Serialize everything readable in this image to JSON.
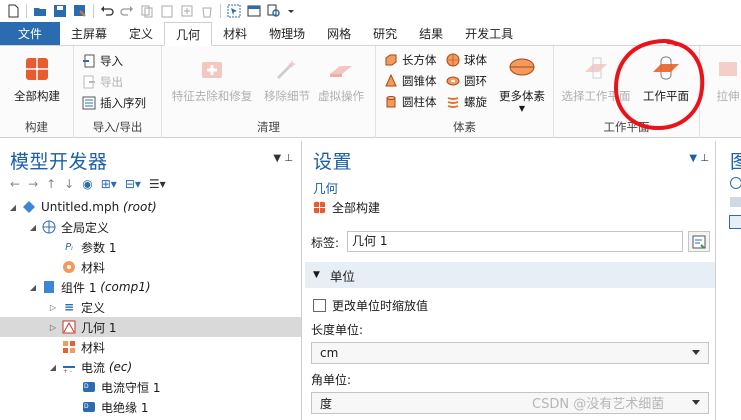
{
  "tabs": {
    "file": "文件",
    "home": "主屏幕",
    "definitions": "定义",
    "geometry": "几何",
    "materials": "材料",
    "physics": "物理场",
    "mesh": "网格",
    "study": "研究",
    "results": "结果",
    "developer": "开发工具"
  },
  "ribbon": {
    "build": {
      "build_all": "全部构建",
      "label": "构建"
    },
    "import_export": {
      "import": "导入",
      "export": "导出",
      "insert_sequence": "插入序列",
      "label": "导入/导出"
    },
    "cleanup": {
      "remove_features": "特征去除和修复",
      "remove_details": "移除细节",
      "virtual_ops": "虚拟操作",
      "label": "清理"
    },
    "primitives": {
      "block": "长方体",
      "sphere": "球体",
      "cone": "圆锥体",
      "torus": "圆环",
      "cylinder": "圆柱体",
      "helix": "螺旋",
      "more": "更多体素",
      "label": "体素"
    },
    "workplane": {
      "select_wp": "选择工作平面",
      "work_plane": "工作平面",
      "label": "工作平面"
    },
    "extrude": "拉伸"
  },
  "model_builder": {
    "title": "模型开发器",
    "tree": {
      "root": "Untitled.mph",
      "root_tag": "(root)",
      "global_defs": "全局定义",
      "parameters": "参数 1",
      "global_materials": "材料",
      "component": "组件 1",
      "component_tag": "(comp1)",
      "definitions": "定义",
      "geometry": "几何 1",
      "materials": "材料",
      "electric_currents": "电流",
      "ec_tag": "(ec)",
      "current_conservation": "电流守恒 1",
      "electric_insulation": "电绝缘 1"
    }
  },
  "settings": {
    "title": "设置",
    "subtitle": "几何",
    "build_all": "全部构建",
    "label_text": "标签:",
    "label_value": "几何 1",
    "units_section": "单位",
    "scale_checkbox": "更改单位时缩放值",
    "length_unit_label": "长度单位:",
    "length_unit": "cm",
    "angular_unit_label": "角单位:",
    "angular_unit": "度"
  },
  "graphics": {
    "title": "图"
  },
  "watermark": "CSDN @没有艺术细菌"
}
